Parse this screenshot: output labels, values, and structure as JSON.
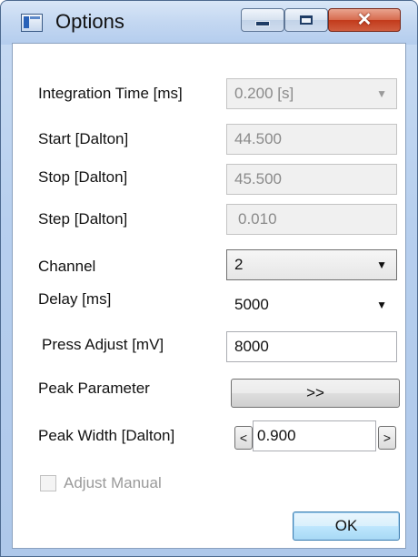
{
  "window": {
    "title": "Options"
  },
  "fields": {
    "integration_time": {
      "label": "Integration Time [ms]",
      "value": "0.200 [s]"
    },
    "start": {
      "label": "Start [Dalton]",
      "value": "44.500"
    },
    "stop": {
      "label": "Stop [Dalton]",
      "value": "45.500"
    },
    "step": {
      "label": "Step [Dalton]",
      "value": "0.010"
    },
    "channel": {
      "label": "Channel",
      "value": "2"
    },
    "delay": {
      "label": "Delay [ms]",
      "value": "5000"
    },
    "press_adjust": {
      "label": "Press Adjust [mV]",
      "value": "8000"
    },
    "peak_parameter": {
      "label": "Peak Parameter",
      "button_label": ">>"
    },
    "peak_width": {
      "label": "Peak Width [Dalton]",
      "value": "0.900",
      "dec_label": "<",
      "inc_label": ">"
    }
  },
  "adjust_manual": {
    "label": "Adjust Manual",
    "checked": false,
    "enabled": false
  },
  "ok_button": {
    "label": "OK"
  }
}
